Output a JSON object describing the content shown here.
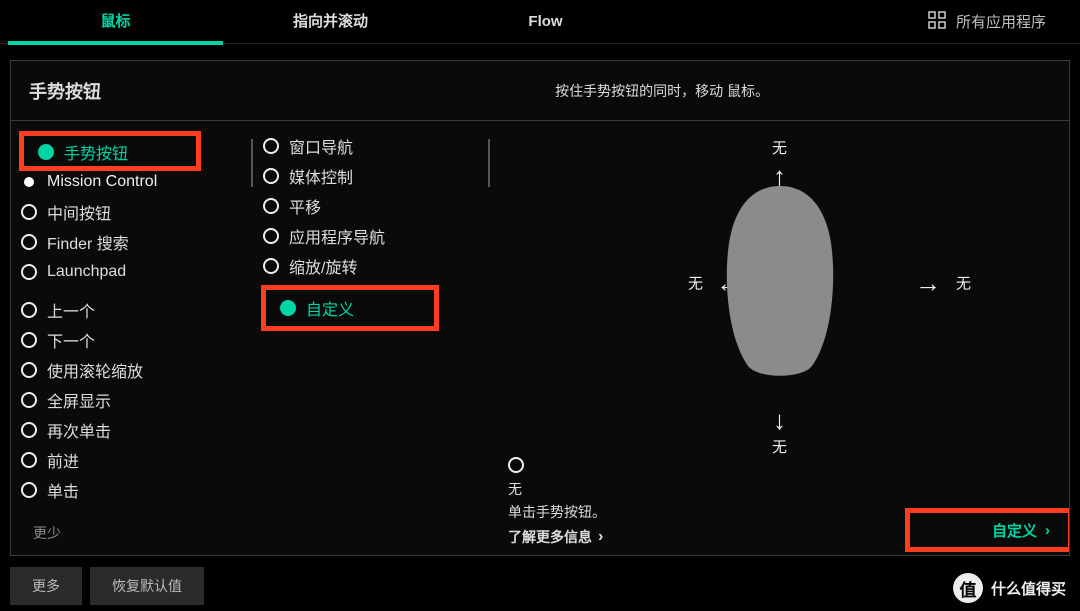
{
  "tabs": {
    "mouse": "鼠标",
    "point_scroll": "指向并滚动",
    "flow": "Flow"
  },
  "all_apps": "所有应用程序",
  "panel": {
    "title": "手势按钮",
    "hint": "按住手势按钮的同时，移动 鼠标。"
  },
  "col1": {
    "selected": "手势按钮",
    "items": [
      "Mission Control",
      "中间按钮",
      "Finder 搜索",
      "Launchpad",
      "上一个",
      "下一个",
      "使用滚轮缩放",
      "全屏显示",
      "再次单击",
      "前进",
      "单击"
    ],
    "fewer": "更少"
  },
  "col2": {
    "items": [
      "窗口导航",
      "媒体控制",
      "平移",
      "应用程序导航",
      "缩放/旋转"
    ],
    "selected": "自定义"
  },
  "dir_none": {
    "top": "无",
    "left": "无",
    "right": "无",
    "bottom": "无"
  },
  "info": {
    "none": "无",
    "click": "单击手势按钮。",
    "learn": "了解更多信息"
  },
  "custom_btn": "自定义",
  "footer": {
    "more": "更多",
    "reset": "恢复默认值"
  },
  "badge": "什么值得买"
}
